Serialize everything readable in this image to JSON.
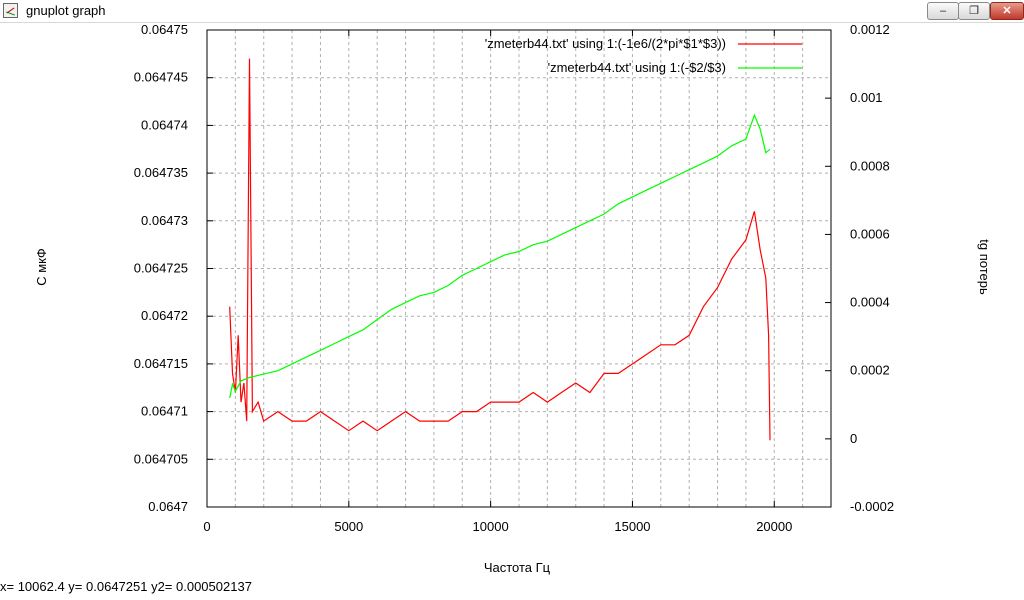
{
  "window": {
    "title": "gnuplot graph",
    "controls": {
      "minimize": "–",
      "maximize": "❐",
      "close": "✕"
    }
  },
  "status_bar": {
    "text": "x= 10062.4 y= 0.0647251 y2= 0.000502137"
  },
  "chart_data": {
    "type": "line",
    "xlabel": "Частота Гц",
    "ylabel": "С мкФ",
    "y2label": "tg потерь",
    "xlim": [
      0,
      22000
    ],
    "ylim": [
      0.0647,
      0.06475
    ],
    "y2lim": [
      -0.0002,
      0.0012
    ],
    "grid": true,
    "legend_position": "top-right",
    "x_ticks": [
      0,
      5000,
      10000,
      15000,
      20000
    ],
    "x_tick_labels": [
      "0",
      "5000",
      "10000",
      "15000",
      "20000"
    ],
    "y_ticks": [
      0.0647,
      0.064705,
      0.06471,
      0.064715,
      0.06472,
      0.064725,
      0.06473,
      0.064735,
      0.06474,
      0.064745,
      0.06475
    ],
    "y_tick_labels": [
      "0.0647",
      "0.064705",
      "0.06471",
      "0.064715",
      "0.06472",
      "0.064725",
      "0.06473",
      "0.064735",
      "0.06474",
      "0.064745",
      "0.06475"
    ],
    "y2_ticks": [
      -0.0002,
      0,
      0.0002,
      0.0004,
      0.0006,
      0.0008,
      0.001,
      0.0012
    ],
    "y2_tick_labels": [
      "-0.0002",
      "0",
      "0.0002",
      "0.0004",
      "0.0006",
      "0.0008",
      "0.001",
      "0.0012"
    ],
    "series": [
      {
        "name": "'zmeterb44.txt' using 1:(-1e6/(2*pi*$1*$3))",
        "axis": "y",
        "color": "#ff0000",
        "x": [
          800,
          900,
          1000,
          1100,
          1200,
          1300,
          1400,
          1500,
          1600,
          1800,
          2000,
          2500,
          3000,
          3500,
          4000,
          4500,
          5000,
          5500,
          6000,
          6500,
          7000,
          7500,
          8000,
          8500,
          9000,
          9500,
          10000,
          10500,
          11000,
          11500,
          12000,
          12500,
          13000,
          13500,
          14000,
          14500,
          15000,
          15500,
          16000,
          16500,
          17000,
          17500,
          18000,
          18500,
          19000,
          19300,
          19500,
          19700,
          19800,
          19850
        ],
        "y": [
          0.064721,
          0.064714,
          0.064712,
          0.064718,
          0.064711,
          0.064713,
          0.064709,
          0.064747,
          0.06471,
          0.064711,
          0.064709,
          0.06471,
          0.064709,
          0.064709,
          0.06471,
          0.064709,
          0.064708,
          0.064709,
          0.064708,
          0.064709,
          0.06471,
          0.064709,
          0.064709,
          0.064709,
          0.06471,
          0.06471,
          0.064711,
          0.064711,
          0.064711,
          0.064712,
          0.064711,
          0.064712,
          0.064713,
          0.064712,
          0.064714,
          0.064714,
          0.064715,
          0.064716,
          0.064717,
          0.064717,
          0.064718,
          0.064721,
          0.064723,
          0.064726,
          0.064728,
          0.064731,
          0.064727,
          0.064724,
          0.064718,
          0.064707
        ]
      },
      {
        "name": "'zmeterb44.txt' using 1:(-$2/$3)",
        "axis": "y2",
        "color": "#00ff00",
        "x": [
          800,
          900,
          1000,
          1200,
          1500,
          2000,
          2500,
          3000,
          3500,
          4000,
          4500,
          5000,
          5500,
          6000,
          6500,
          7000,
          7500,
          8000,
          8500,
          9000,
          9500,
          10000,
          10500,
          11000,
          11500,
          12000,
          12500,
          13000,
          13500,
          14000,
          14500,
          15000,
          15500,
          16000,
          16500,
          17000,
          17500,
          18000,
          18500,
          19000,
          19300,
          19500,
          19700,
          19850
        ],
        "y": [
          0.00012,
          0.00016,
          0.00014,
          0.00017,
          0.00018,
          0.00019,
          0.0002,
          0.00022,
          0.00024,
          0.00026,
          0.00028,
          0.0003,
          0.00032,
          0.00035,
          0.00038,
          0.0004,
          0.00042,
          0.00043,
          0.00045,
          0.00048,
          0.0005,
          0.00052,
          0.00054,
          0.00055,
          0.00057,
          0.00058,
          0.0006,
          0.00062,
          0.00064,
          0.00066,
          0.00069,
          0.00071,
          0.00073,
          0.00075,
          0.00077,
          0.00079,
          0.00081,
          0.00083,
          0.00086,
          0.00088,
          0.00095,
          0.00091,
          0.00084,
          0.00085
        ]
      }
    ]
  }
}
